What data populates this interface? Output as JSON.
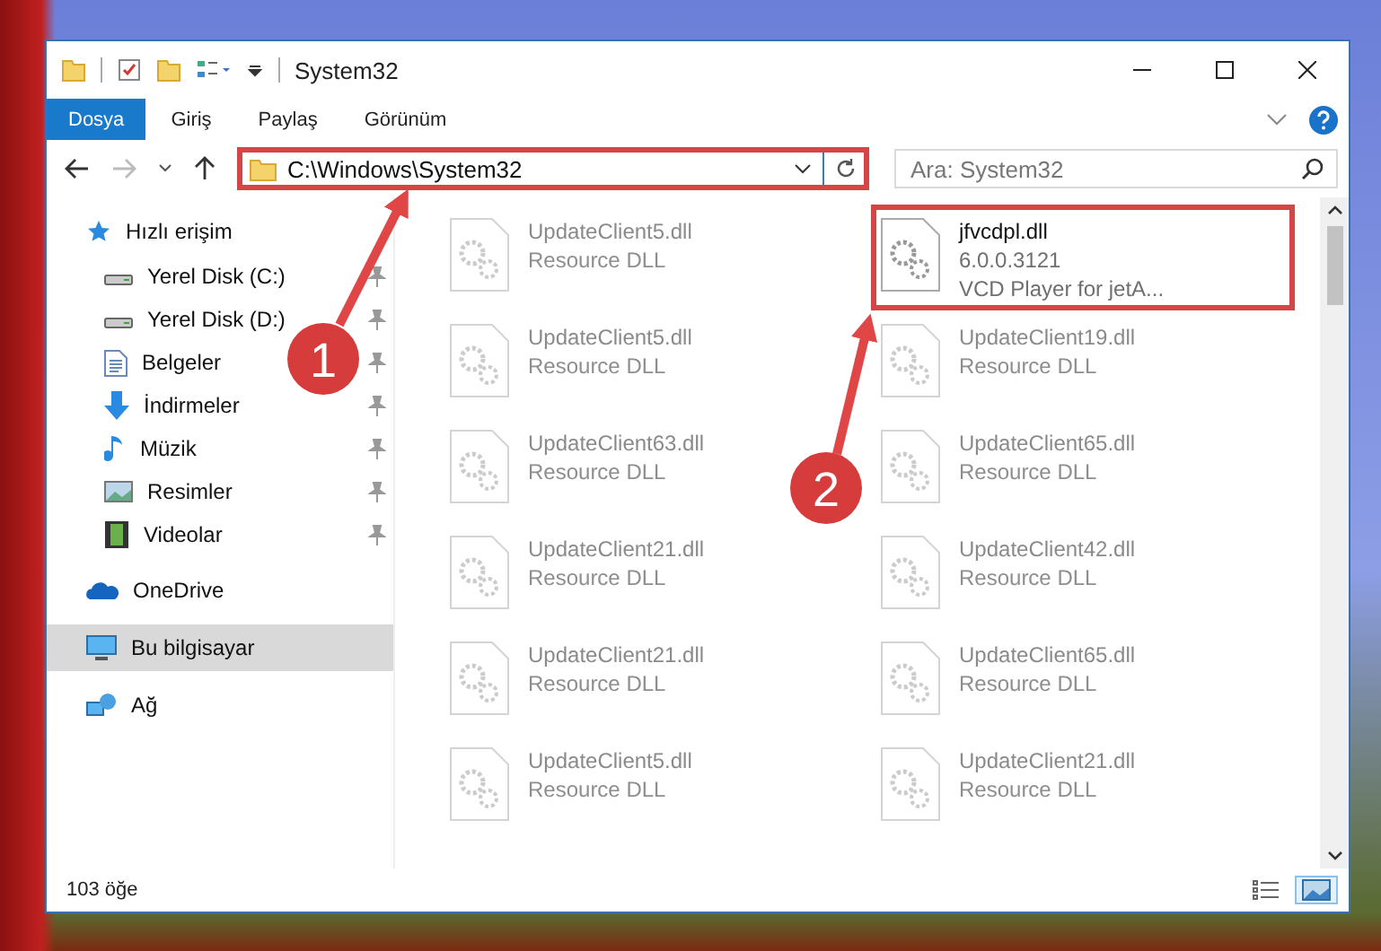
{
  "window": {
    "title": "System32"
  },
  "ribbon_tabs": [
    {
      "label": "Dosya",
      "selected": true
    },
    {
      "label": "Giriş",
      "selected": false
    },
    {
      "label": "Paylaş",
      "selected": false
    },
    {
      "label": "Görünüm",
      "selected": false
    }
  ],
  "address_bar": {
    "path": "C:\\Windows\\System32",
    "highlighted": true
  },
  "search": {
    "placeholder": "Ara: System32"
  },
  "sidebar": {
    "items": [
      {
        "label": "Hızlı erişim",
        "selected": false,
        "children": [
          {
            "label": "Yerel Disk (C:)",
            "pinned": true
          },
          {
            "label": "Yerel Disk (D:)",
            "pinned": true
          },
          {
            "label": "Belgeler",
            "pinned": true
          },
          {
            "label": "İndirmeler",
            "pinned": true
          },
          {
            "label": "Müzik",
            "pinned": true
          },
          {
            "label": "Resimler",
            "pinned": true
          },
          {
            "label": "Videolar",
            "pinned": true
          }
        ]
      },
      {
        "label": "OneDrive",
        "selected": false
      },
      {
        "label": "Bu bilgisayar",
        "selected": true
      },
      {
        "label": "Ağ",
        "selected": false
      }
    ]
  },
  "files": [
    {
      "name": "UpdateClient5.dll",
      "lines": [
        "Resource DLL"
      ],
      "faded": true,
      "highlighted": false
    },
    {
      "name": "jfvcdpl.dll",
      "lines": [
        "6.0.0.3121",
        "VCD Player for jetA..."
      ],
      "faded": false,
      "highlighted": true
    },
    {
      "name": "UpdateClient5.dll",
      "lines": [
        "Resource DLL"
      ],
      "faded": true,
      "highlighted": false
    },
    {
      "name": "UpdateClient19.dll",
      "lines": [
        "Resource DLL"
      ],
      "faded": true,
      "highlighted": false
    },
    {
      "name": "UpdateClient63.dll",
      "lines": [
        "Resource DLL"
      ],
      "faded": true,
      "highlighted": false
    },
    {
      "name": "UpdateClient65.dll",
      "lines": [
        "Resource DLL"
      ],
      "faded": true,
      "highlighted": false
    },
    {
      "name": "UpdateClient21.dll",
      "lines": [
        "Resource DLL"
      ],
      "faded": true,
      "highlighted": false
    },
    {
      "name": "UpdateClient42.dll",
      "lines": [
        "Resource DLL"
      ],
      "faded": true,
      "highlighted": false
    },
    {
      "name": "UpdateClient21.dll",
      "lines": [
        "Resource DLL"
      ],
      "faded": true,
      "highlighted": false
    },
    {
      "name": "UpdateClient65.dll",
      "lines": [
        "Resource DLL"
      ],
      "faded": true,
      "highlighted": false
    },
    {
      "name": "UpdateClient5.dll",
      "lines": [
        "Resource DLL"
      ],
      "faded": true,
      "highlighted": false
    },
    {
      "name": "UpdateClient21.dll",
      "lines": [
        "Resource DLL"
      ],
      "faded": true,
      "highlighted": false
    }
  ],
  "status_bar": {
    "count": "103 öğe"
  },
  "views": [
    {
      "kind": "details",
      "selected": false
    },
    {
      "kind": "large-icons",
      "selected": true
    }
  ],
  "callouts": [
    {
      "label": "1"
    },
    {
      "label": "2"
    }
  ]
}
